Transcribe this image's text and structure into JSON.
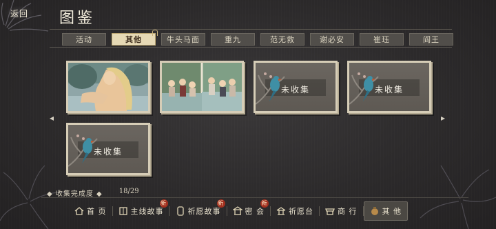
{
  "header": {
    "back_label": "返回",
    "title": "图鉴"
  },
  "tabs": [
    {
      "label": "活动",
      "active": false
    },
    {
      "label": "其他",
      "active": true
    },
    {
      "label": "牛头马面",
      "active": false
    },
    {
      "label": "重九",
      "active": false
    },
    {
      "label": "范无救",
      "active": false
    },
    {
      "label": "谢必安",
      "active": false
    },
    {
      "label": "崔珏",
      "active": false
    },
    {
      "label": "阎王",
      "active": false
    }
  ],
  "cards": [
    {
      "kind": "illustration-bath",
      "label": ""
    },
    {
      "kind": "illustration-group",
      "label": ""
    },
    {
      "kind": "locked",
      "label": "未收集"
    },
    {
      "kind": "locked",
      "label": "未收集"
    },
    {
      "kind": "locked",
      "label": "未收集"
    }
  ],
  "progress": {
    "label": "收集完成度",
    "value": "18/29"
  },
  "bottom_nav": [
    {
      "label": "首 页",
      "icon": "home-icon",
      "badge": ""
    },
    {
      "label": "主线故事",
      "icon": "book-icon",
      "badge": "新"
    },
    {
      "label": "祈愿故事",
      "icon": "scroll-icon",
      "badge": "新"
    },
    {
      "label": "密 会",
      "icon": "pavilion-icon",
      "badge": "新"
    },
    {
      "label": "祈愿台",
      "icon": "altar-icon",
      "badge": ""
    },
    {
      "label": "商 行",
      "icon": "shop-icon",
      "badge": ""
    },
    {
      "label": "其 他",
      "icon": "pouch-icon",
      "badge": "",
      "active": true
    }
  ],
  "colors": {
    "accent_tab": "#e6d9b5",
    "badge": "#a3301f"
  }
}
